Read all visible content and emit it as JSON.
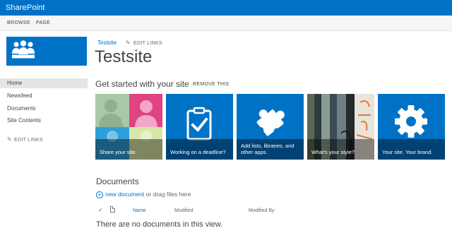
{
  "suite": {
    "brand": "SharePoint"
  },
  "ribbon": {
    "tabs": [
      "BROWSE",
      "PAGE"
    ]
  },
  "site": {
    "breadcrumb": "Testsite",
    "edit_links": "EDIT LINKS",
    "title": "Testsite"
  },
  "nav": {
    "items": [
      "Home",
      "Newsfeed",
      "Documents",
      "Site Contents"
    ],
    "selected": "Home",
    "edit_links": "EDIT LINKS"
  },
  "get_started": {
    "title": "Get started with your site",
    "remove": "REMOVE THIS",
    "tiles": [
      {
        "caption": "Share your site.",
        "icon": "people-tile-image"
      },
      {
        "caption": "Working on a deadline?",
        "icon": "clipboard-check-icon"
      },
      {
        "caption": "Add lists, libraries, and other apps.",
        "icon": "puzzle-icon"
      },
      {
        "caption": "What's your style?",
        "icon": "style-tile-image"
      },
      {
        "caption": "Your site. Your brand.",
        "icon": "gear-icon"
      }
    ]
  },
  "documents": {
    "title": "Documents",
    "new_document": "new document",
    "drag_text": "or drag files here",
    "columns": {
      "check": "✓",
      "name": "Name",
      "modified": "Modified",
      "modified_by": "Modified By"
    },
    "empty": "There are no documents in this view."
  },
  "colors": {
    "accent": "#0072c6",
    "tile_caption_overlay": "rgba(0,0,0,0.42)"
  }
}
